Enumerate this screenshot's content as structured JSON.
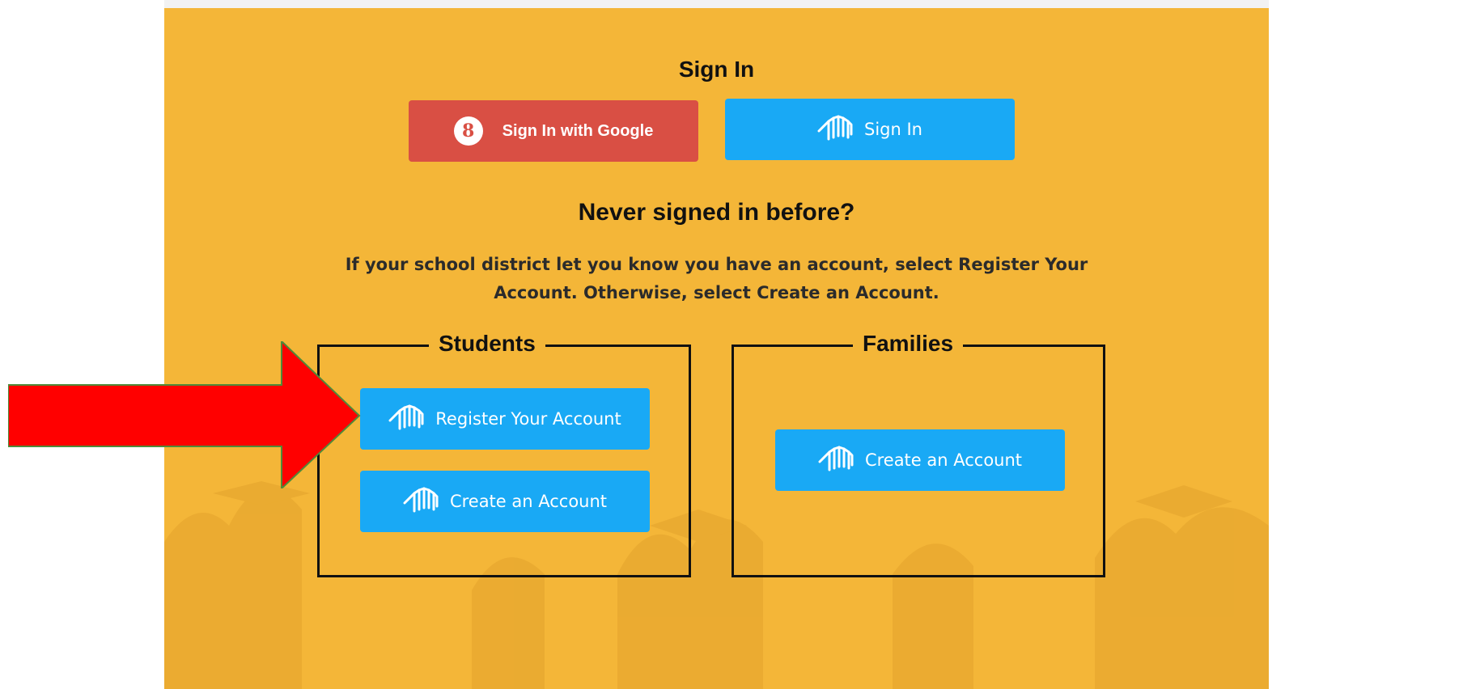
{
  "signin": {
    "title": "Sign In",
    "google_button_label": "Sign In with Google",
    "google_icon_glyph": "8",
    "signin_button_label": "Sign In"
  },
  "register": {
    "title": "Never signed in before?",
    "info_line_1": "If your school district let you know you have an account, select Register Your",
    "info_line_2": "Account. Otherwise, select Create an Account."
  },
  "students": {
    "legend": "Students",
    "register_button_label": "Register Your Account",
    "create_button_label": "Create an Account"
  },
  "families": {
    "legend": "Families",
    "create_button_label": "Create an Account"
  },
  "icons": {
    "google": "google-icon",
    "brand": "stacked-pages-logo-icon",
    "annotation": "red-arrow"
  },
  "colors": {
    "background_panel": "#f4b638",
    "google_button": "#d94f44",
    "blue_button": "#19a9f5",
    "arrow_fill": "#ff0000",
    "arrow_border": "#4f8a3a"
  }
}
